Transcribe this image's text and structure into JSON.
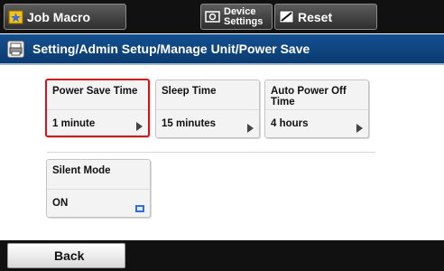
{
  "toolbar": {
    "job_macro_label": "Job Macro",
    "device_settings_line1": "Device",
    "device_settings_line2": "Settings",
    "reset_label": "Reset"
  },
  "breadcrumb": {
    "path": "Setting/Admin Setup/Manage Unit/Power Save"
  },
  "tiles": [
    {
      "title": "Power Save Time",
      "value": "1 minute",
      "selected": true
    },
    {
      "title": "Sleep Time",
      "value": "15 minutes",
      "selected": false
    },
    {
      "title": "Auto Power Off Time",
      "value": "4 hours",
      "selected": false
    },
    {
      "title": "Silent Mode",
      "value": "ON",
      "selected": false
    }
  ],
  "footer": {
    "back_label": "Back"
  },
  "colors": {
    "selected_border": "#d2141e",
    "breadcrumb_bg": "#14508f",
    "toolbar_bg": "#111111"
  }
}
